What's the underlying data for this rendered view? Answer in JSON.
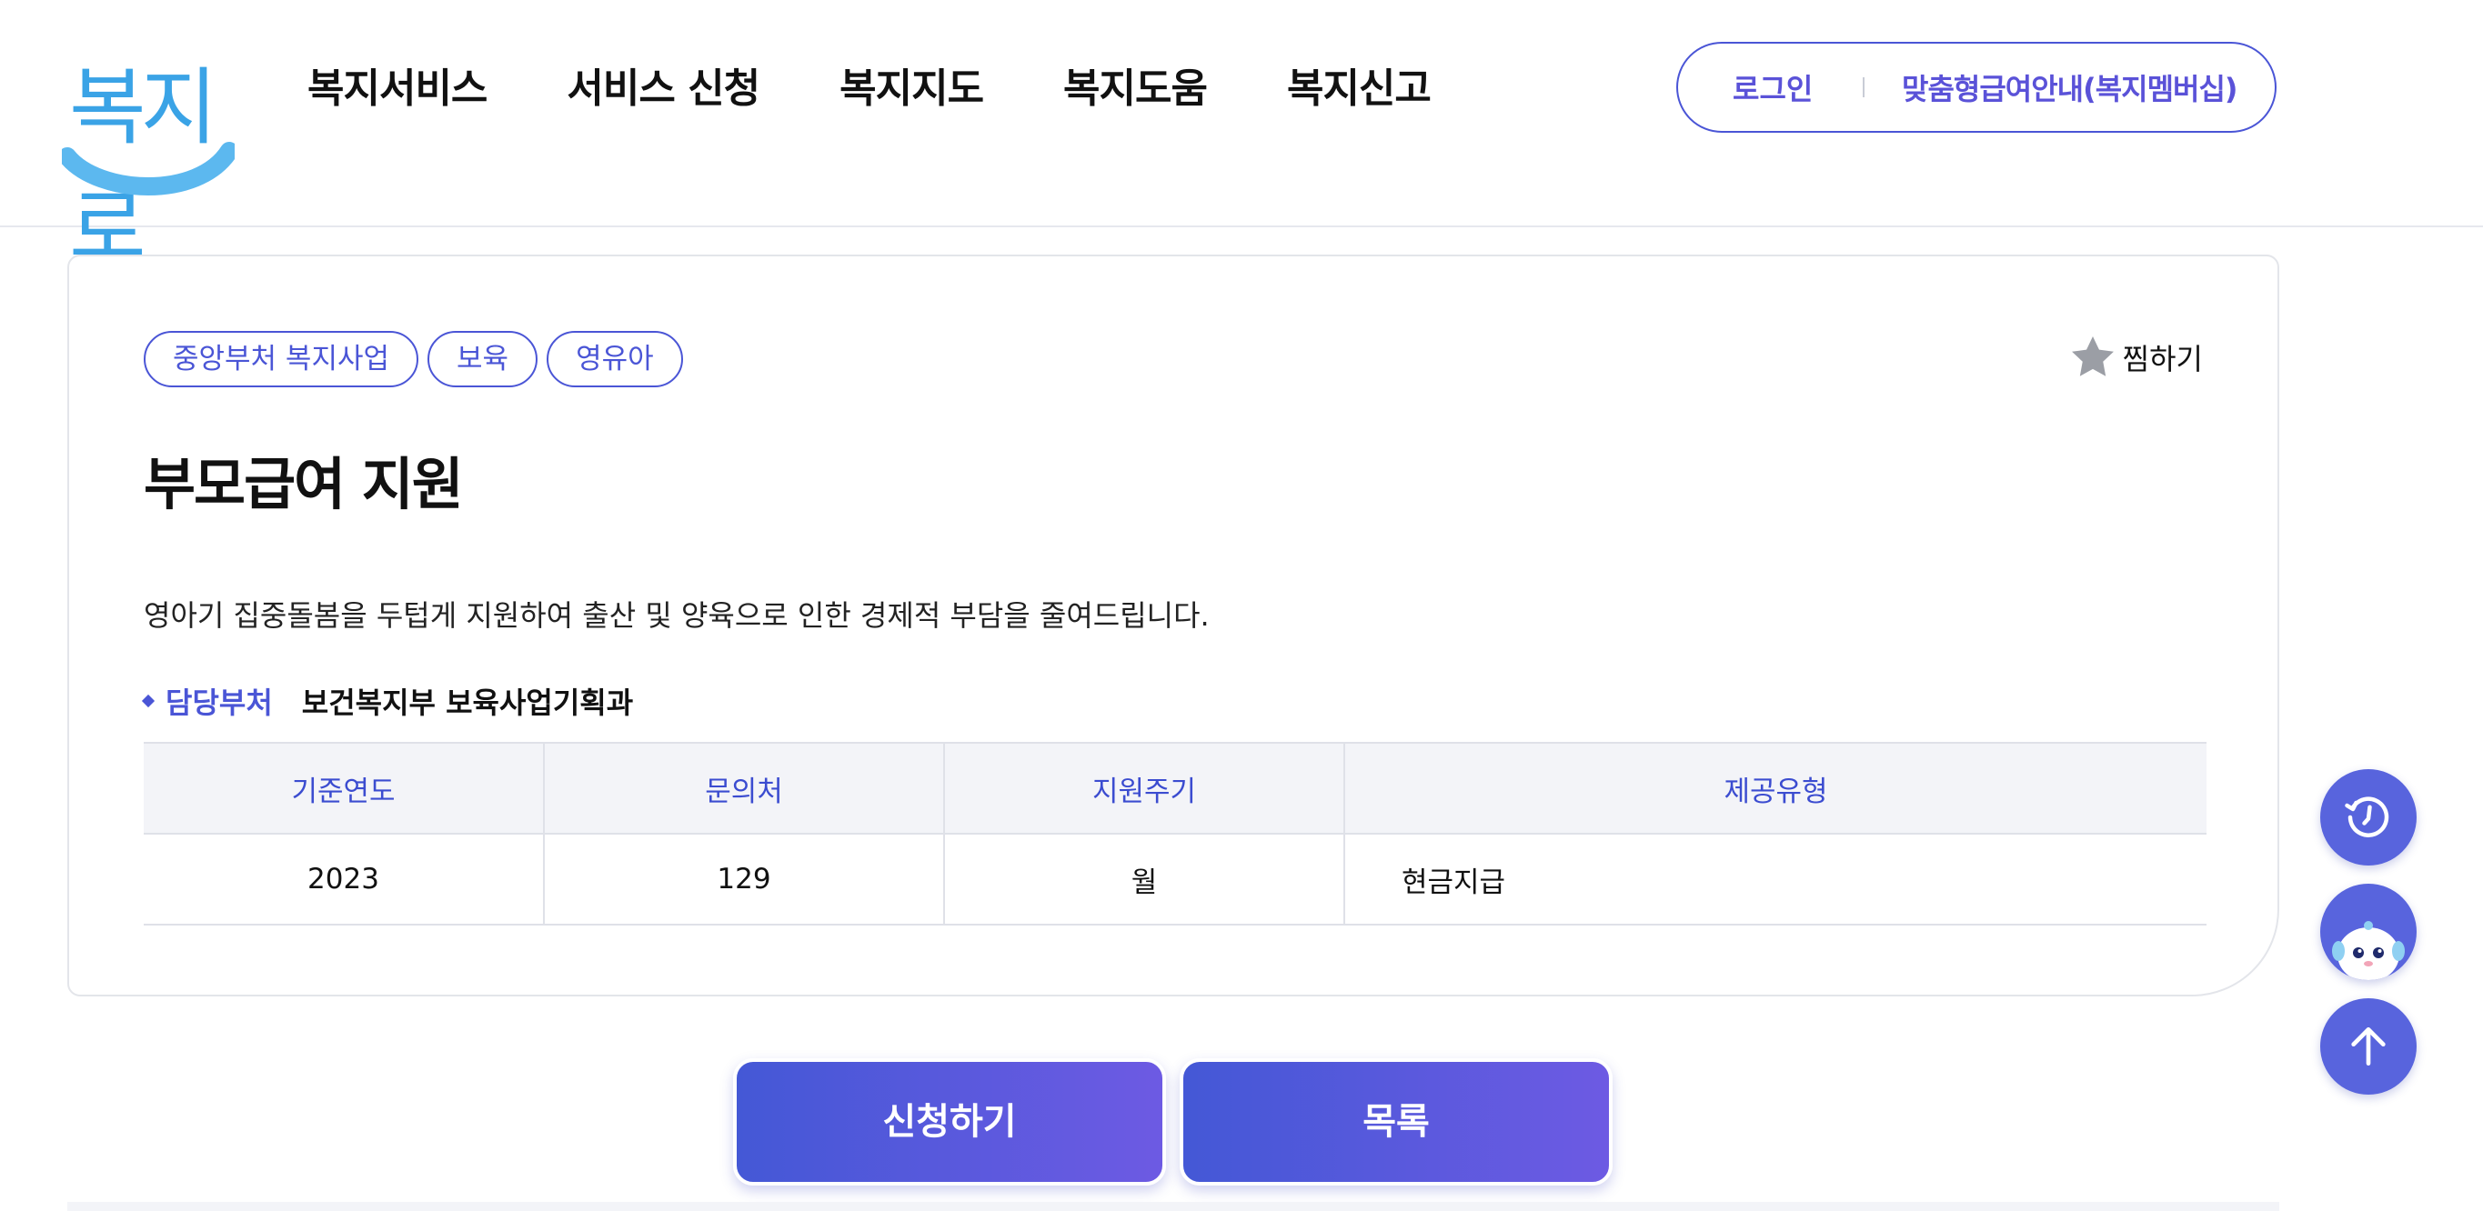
{
  "header": {
    "logo_text": "복지로",
    "nav": [
      "복지서비스",
      "서비스 신청",
      "복지지도",
      "복지도움",
      "복지신고"
    ],
    "login_label": "로그인",
    "membership_label": "맞춤형급여안내(복지멤버십)"
  },
  "service": {
    "tags": [
      "중앙부처 복지사업",
      "보육",
      "영유아"
    ],
    "favorite_label": "찜하기",
    "title": "부모급여 지원",
    "description": "영아기 집중돌봄을 두텁게 지원하여 출산 및 양육으로 인한 경제적 부담을 줄여드립니다.",
    "department_label": "담당부처",
    "department_value": "보건복지부 보육사업기획과",
    "table": {
      "headers": [
        "기준연도",
        "문의처",
        "지원주기",
        "제공유형"
      ],
      "row": [
        "2023",
        "129",
        "월",
        "현금지급"
      ]
    }
  },
  "actions": {
    "apply_label": "신청하기",
    "list_label": "목록"
  },
  "floating": {
    "icons": [
      "history-icon",
      "chatbot-icon",
      "arrow-up-icon"
    ]
  },
  "colors": {
    "accent": "#4a55d6",
    "logo": "#3aa3e6",
    "button_gradient_start": "#4458d6",
    "button_gradient_end": "#6d5ae3"
  }
}
